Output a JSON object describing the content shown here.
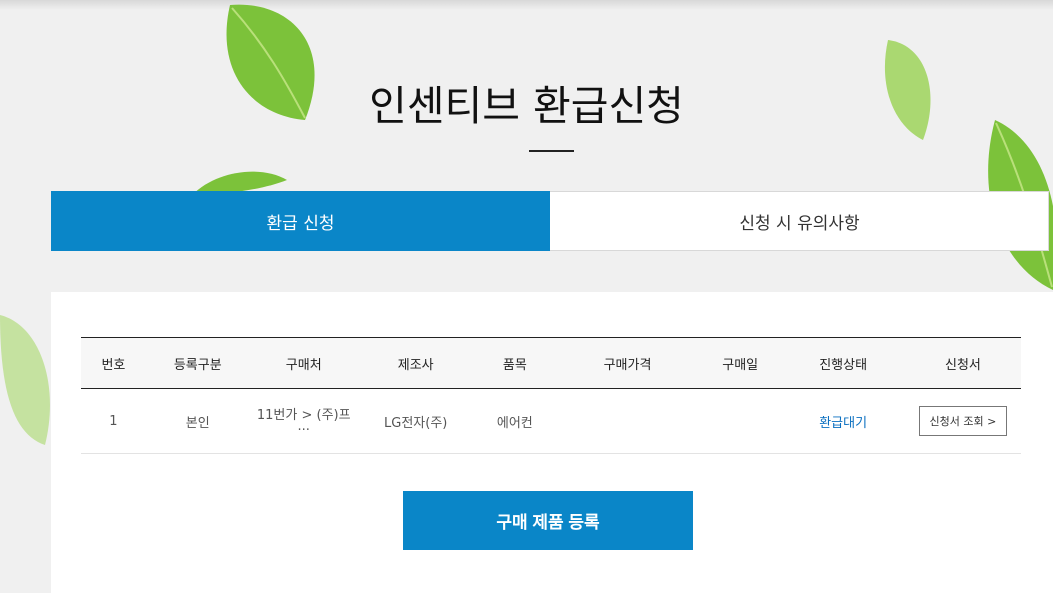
{
  "page": {
    "title": "인센티브 환급신청"
  },
  "tabs": [
    {
      "label": "환급 신청",
      "active": true
    },
    {
      "label": "신청 시 유의사항",
      "active": false
    }
  ],
  "table": {
    "headers": [
      "번호",
      "등록구분",
      "구매처",
      "제조사",
      "품목",
      "구매가격",
      "구매일",
      "진행상태",
      "신청서"
    ],
    "rows": [
      {
        "no": "1",
        "type": "본인",
        "store": "11번가 > (주)프···",
        "maker": "LG전자(주)",
        "item": "에어컨",
        "price": "",
        "date": "",
        "status": "환급대기",
        "form_button": "신청서 조회 >"
      }
    ]
  },
  "register_button": "구매 제품 등록",
  "colors": {
    "accent": "#0a86c8",
    "status": "#0a6fc0"
  },
  "decor": [
    "leaf-icon"
  ]
}
